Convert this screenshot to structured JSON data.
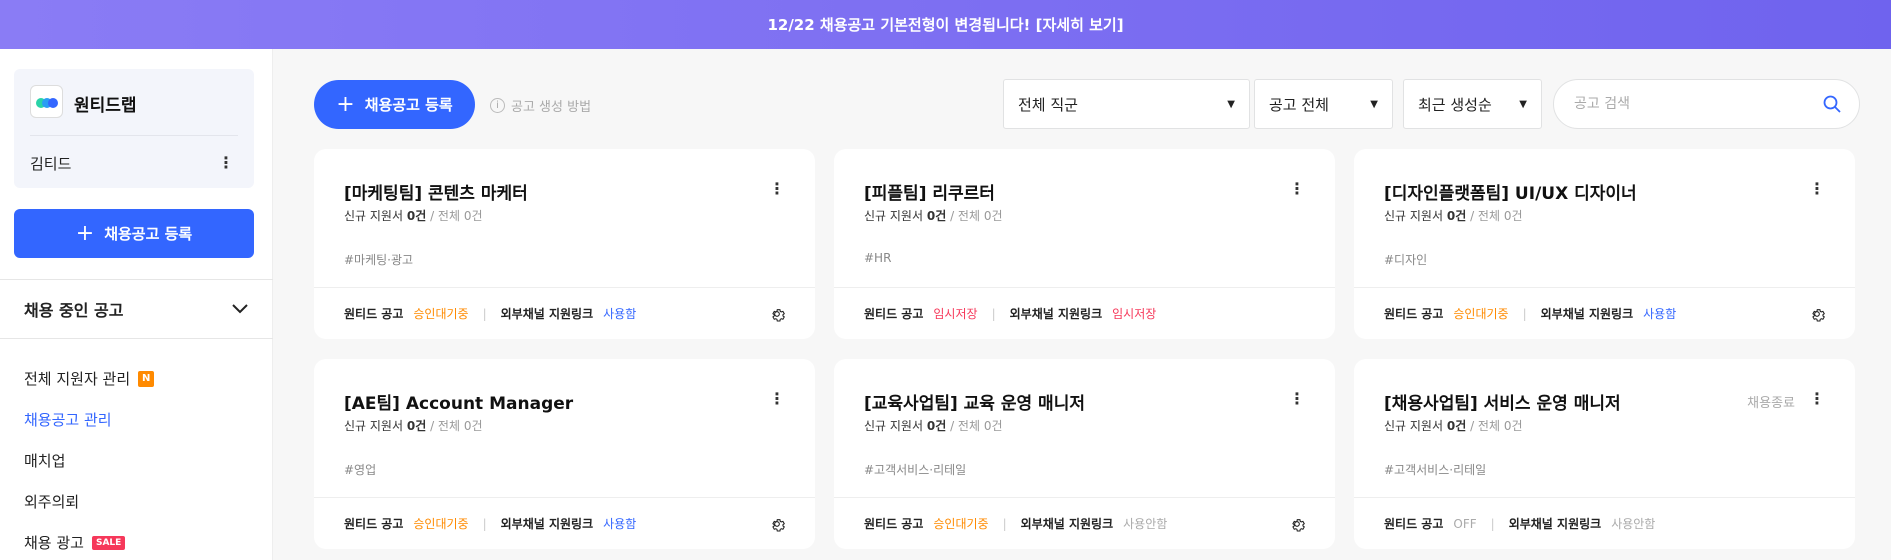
{
  "banner": {
    "text": "12/22 채용공고 기본전형이 변경됩니다! [자세히 보기]"
  },
  "sidebar": {
    "company_name": "원티드랩",
    "user_name": "김티드",
    "register_button": "채용공고 등록",
    "section_title": "채용 중인 공고",
    "nav": [
      {
        "label": "전체 지원자 관리",
        "badge": "N"
      },
      {
        "label": "채용공고 관리",
        "active": true
      },
      {
        "label": "매치업"
      },
      {
        "label": "외주의뢰"
      },
      {
        "label": "채용 광고",
        "badge": "SALE"
      }
    ]
  },
  "toolbar": {
    "register_button": "채용공고 등록",
    "help_text": "공고 생성 방법",
    "filter_job": "전체 직군",
    "filter_status": "공고 전체",
    "sort": "최근 생성순",
    "search_placeholder": "공고 검색"
  },
  "labels": {
    "new_applicants": "신규 지원서",
    "wanted_post": "원티드 공고",
    "external_link": "외부채널 지원링크"
  },
  "cards": [
    {
      "title": "[마케팅팀] 콘텐츠 마케터",
      "new_count": "0건",
      "total": "/ 전체 0건",
      "tag": "#마케팅·광고",
      "wanted_status": "승인대기중",
      "external_status": "사용함",
      "closed": ""
    },
    {
      "title": "[피플팀] 리쿠르터",
      "new_count": "0건",
      "total": "/ 전체 0건",
      "tag": "#HR",
      "wanted_status": "임시저장",
      "external_status": "임시저장",
      "closed": ""
    },
    {
      "title": "[디자인플랫폼팀] UI/UX 디자이너",
      "new_count": "0건",
      "total": "/ 전체 0건",
      "tag": "#디자인",
      "wanted_status": "승인대기중",
      "external_status": "사용함",
      "closed": ""
    },
    {
      "title": "[AE팀] Account Manager",
      "new_count": "0건",
      "total": "/ 전체 0건",
      "tag": "#영업",
      "wanted_status": "승인대기중",
      "external_status": "사용함",
      "closed": ""
    },
    {
      "title": "[교육사업팀] 교육 운영 매니저",
      "new_count": "0건",
      "total": "/ 전체 0건",
      "tag": "#고객서비스·리테일",
      "wanted_status": "승인대기중",
      "external_status": "사용안함",
      "closed": ""
    },
    {
      "title": "[채용사업팀] 서비스 운영 매니저",
      "new_count": "0건",
      "total": "/ 전체 0건",
      "tag": "#고객서비스·리테일",
      "wanted_status": "OFF",
      "external_status": "사용안함",
      "closed": "채용종료"
    }
  ],
  "colors": {
    "primary": "#3366ff",
    "pending": "#ff8a00",
    "draft": "#f6385a",
    "muted": "#aaaaaa",
    "banner": "#7d6ff2"
  }
}
